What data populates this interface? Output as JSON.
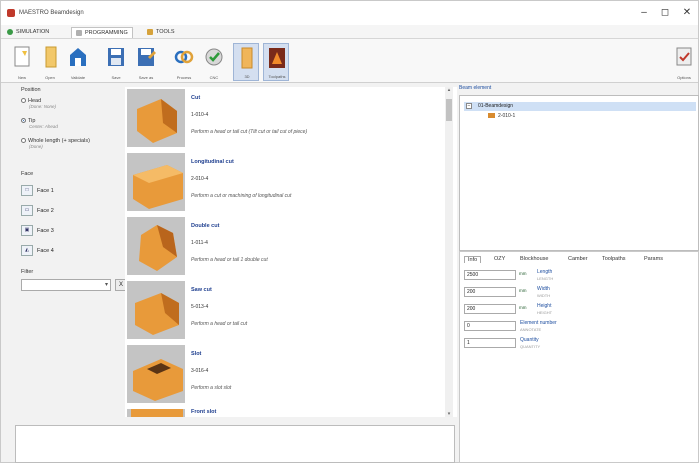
{
  "window": {
    "title": "MAESTRO Beamdesign",
    "controls": {
      "minimize": "–",
      "maximize": "◻",
      "close": "✕"
    }
  },
  "tabs": [
    {
      "label": "SIMULATION"
    },
    {
      "label": "PROGRAMMING"
    },
    {
      "label": "TOOLS"
    }
  ],
  "toolbar": {
    "buttons": [
      {
        "label": "New",
        "icon": "new-file-icon"
      },
      {
        "label": "Open",
        "icon": "open-icon"
      },
      {
        "label": "Validate",
        "icon": "house-icon"
      },
      {
        "label": "Save",
        "icon": "save-icon"
      },
      {
        "label": "Save as",
        "icon": "save-as-icon"
      },
      {
        "label": "Process",
        "icon": "link-process-icon"
      },
      {
        "label": "CNC",
        "icon": "cnc-check-icon"
      },
      {
        "label": "3D",
        "icon": "beam-3d-icon"
      },
      {
        "label": "Toolpaths",
        "icon": "toolpaths-icon"
      }
    ],
    "right_button": {
      "label": "Options",
      "icon": "options-icon"
    }
  },
  "left_panel": {
    "position": {
      "header": "Position",
      "options": [
        {
          "label": "Head",
          "sub": "(Done: None)",
          "selected": false
        },
        {
          "label": "Tip",
          "sub": "Center: Ahead",
          "selected": true
        },
        {
          "label": "Whole length (+ specials)",
          "sub": "(Done)",
          "selected": false
        }
      ]
    },
    "face": {
      "header": "Face",
      "buttons": [
        "Face 1",
        "Face 2",
        "Face 3",
        "Face 4"
      ]
    },
    "filter": {
      "header": "Filter",
      "value": "",
      "clear_label": "X"
    }
  },
  "operations": [
    {
      "name": "Cut",
      "code": "1-010-4",
      "desc": "Perform a head or tail cut (Tilt cut or tail cut of piece)"
    },
    {
      "name": "Longitudinal cut",
      "code": "2-010-4",
      "desc": "Perform a cut or machining of longitudinal cut"
    },
    {
      "name": "Double cut",
      "code": "1-011-4",
      "desc": "Perform a head or tail 1 double cut"
    },
    {
      "name": "Saw cut",
      "code": "5-013-4",
      "desc": "Perform a head or tail cut"
    },
    {
      "name": "Slot",
      "code": "3-016-4",
      "desc": "Perform a slot slot"
    },
    {
      "name": "Front slot",
      "code": "",
      "desc": ""
    }
  ],
  "tree": {
    "header": "Beam element",
    "root": "01-Beamdesign",
    "child": "2-010-1"
  },
  "properties": {
    "tabs": [
      "Info",
      "OZY",
      "Blockhouse",
      "Camber",
      "Toolpaths",
      "Params"
    ],
    "rows": [
      {
        "value": "2500",
        "unit": "mm",
        "label": "Length",
        "note": "LENGTH"
      },
      {
        "value": "200",
        "unit": "mm",
        "label": "Width",
        "note": "WIDTH"
      },
      {
        "value": "200",
        "unit": "mm",
        "label": "Height",
        "note": "HEIGHT"
      },
      {
        "value": "0",
        "unit": "",
        "label": "Element number",
        "note": "ANNOTATE"
      },
      {
        "value": "1",
        "unit": "",
        "label": "Quantity",
        "note": "QUANTITY"
      }
    ]
  },
  "colors": {
    "accent": "#1e5aa8",
    "wood": "#e08a2c",
    "link": "#1f3f8f"
  }
}
